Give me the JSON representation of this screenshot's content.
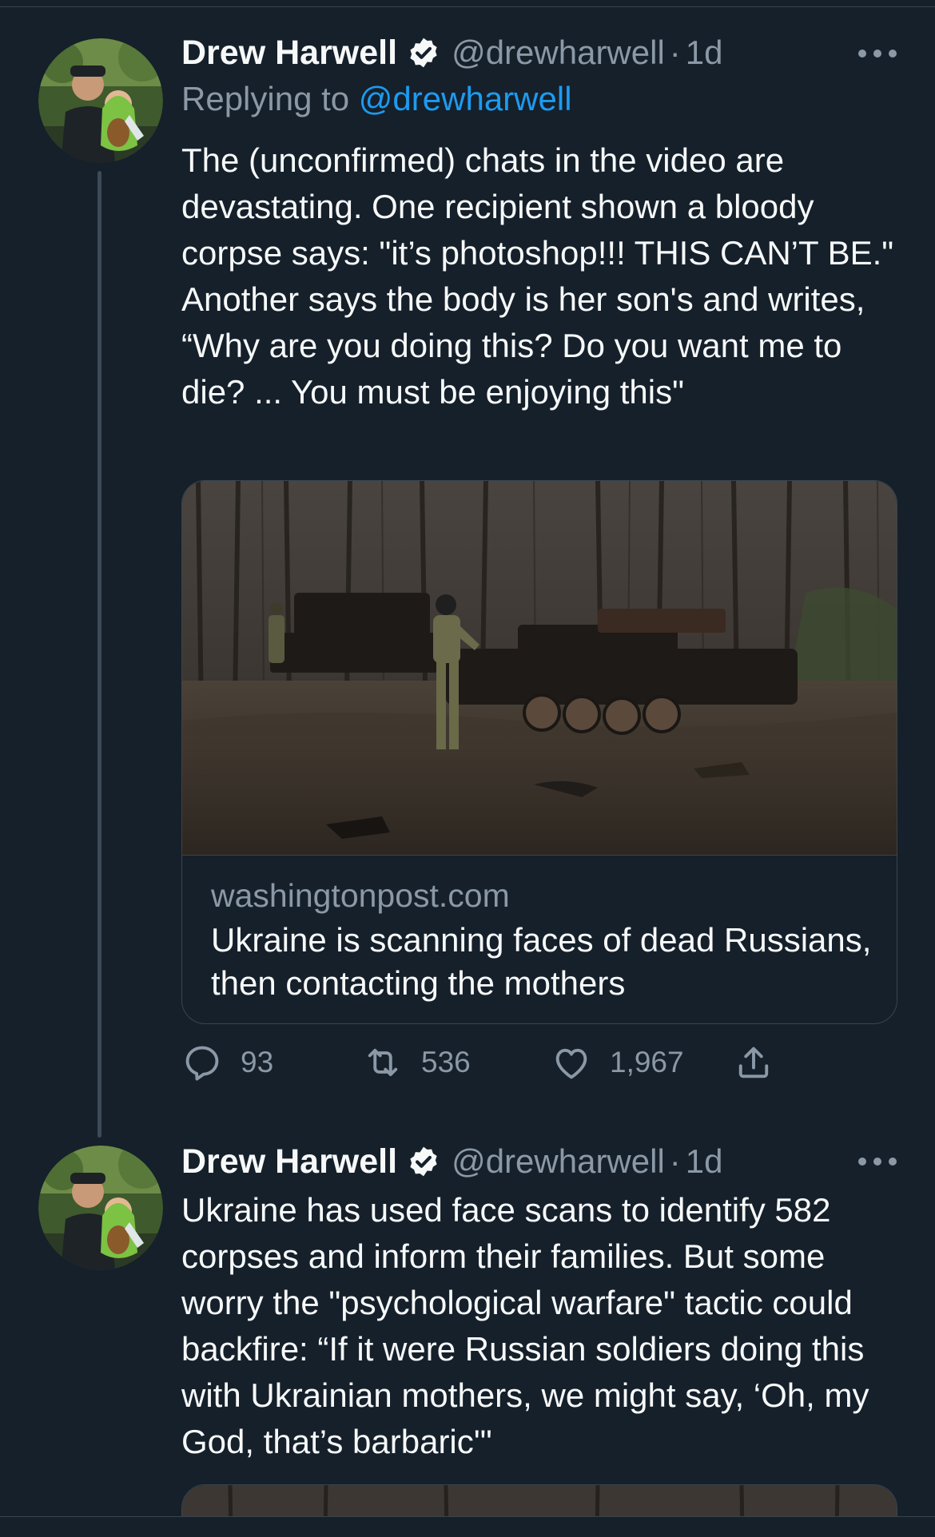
{
  "thread": {
    "tweets": [
      {
        "author": {
          "name": "Drew Harwell",
          "handle": "@drewharwell",
          "separator": "·",
          "time": "1d",
          "avatar_icon": "avatar-photo-icon",
          "verified_icon": "verified-badge-icon"
        },
        "replying_to": {
          "label": "Replying to",
          "mention": "@drewharwell"
        },
        "text": "The (unconfirmed) chats in the video are devastating. One recipient shown a bloody corpse says: \"it’s photoshop!!! THIS CAN’T BE.\" Another says the body is her son's and writes, “Why are you doing this? Do you want me to die? ... You must be enjoying this\"",
        "card": {
          "domain": "washingtonpost.com",
          "title": "Ukraine is scanning faces of dead Russians, then contacting the mothers"
        },
        "actions": {
          "replies": "93",
          "retweets": "536",
          "likes": "1,967"
        }
      },
      {
        "author": {
          "name": "Drew Harwell",
          "handle": "@drewharwell",
          "separator": "·",
          "time": "1d",
          "avatar_icon": "avatar-photo-icon",
          "verified_icon": "verified-badge-icon"
        },
        "text": "Ukraine has used face scans to identify 582 corpses and inform their families. But some worry the \"psychological warfare\" tactic could backfire: “If it were Russian soldiers doing this with Ukrainian mothers, we might say, ‘Oh, my God, that’s barbaric'\""
      }
    ]
  },
  "theme": {
    "background": "#15202b",
    "text_primary": "#f7f9f9",
    "text_secondary": "#8b98a5",
    "accent": "#1d9bf0",
    "border": "#38444d"
  }
}
